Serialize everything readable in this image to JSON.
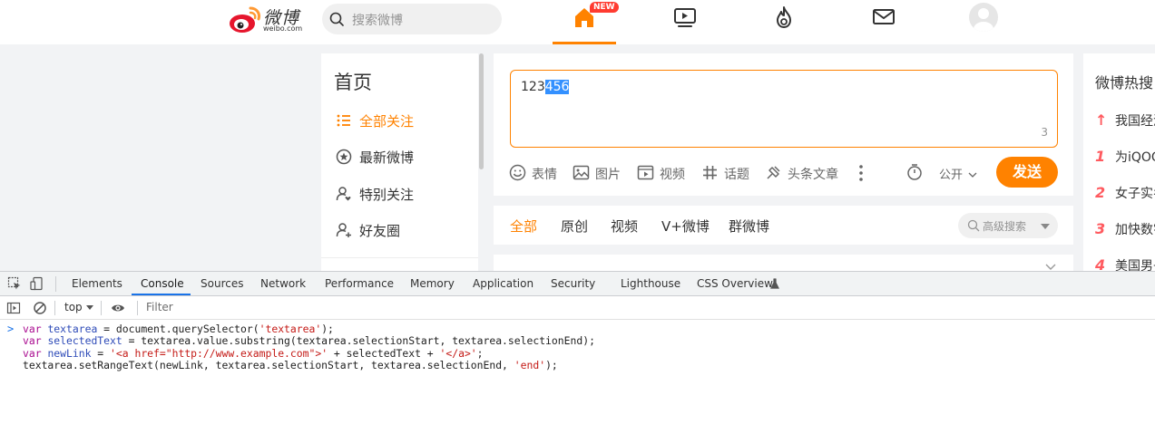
{
  "colors": {
    "brand_orange": "#ff8200",
    "hot_red": "#ff5a5f",
    "selection_blue": "#3390ff",
    "devtools_accent": "#1a73e8"
  },
  "header": {
    "logo_text": "微博",
    "logo_sub": "weibo.com",
    "search_placeholder": "搜索微博",
    "new_badge": "NEW",
    "nav_icons": [
      "home-icon",
      "video-icon",
      "hot-flame-icon",
      "mail-icon",
      "avatar"
    ]
  },
  "leftnav": {
    "title": "首页",
    "items": [
      {
        "label": "全部关注",
        "icon": "list-icon",
        "active": true
      },
      {
        "label": "最新微博",
        "icon": "star-circle-icon",
        "active": false
      },
      {
        "label": "特别关注",
        "icon": "user-heart-icon",
        "active": false
      },
      {
        "label": "好友圈",
        "icon": "user-group-icon",
        "active": false
      }
    ]
  },
  "composer": {
    "text_before": "123",
    "text_selected": "456",
    "char_count": "3",
    "tools": [
      {
        "label": "表情",
        "icon": "emoji-icon"
      },
      {
        "label": "图片",
        "icon": "image-icon"
      },
      {
        "label": "视频",
        "icon": "video-icon"
      },
      {
        "label": "话题",
        "icon": "hashtag-icon"
      },
      {
        "label": "头条文章",
        "icon": "article-icon"
      }
    ],
    "visibility": "公开",
    "send_label": "发送"
  },
  "feed_tabs": {
    "items": [
      "全部",
      "原创",
      "视频",
      "V+微博",
      "群微博"
    ],
    "active_index": 0,
    "advanced_search": "高级搜索"
  },
  "hot": {
    "title": "微博热搜",
    "items": [
      {
        "rank": "↑",
        "text": "我国经济"
      },
      {
        "rank": "1",
        "text": "为iQOO"
      },
      {
        "rank": "2",
        "text": "女子实名"
      },
      {
        "rank": "3",
        "text": "加快数字"
      },
      {
        "rank": "4",
        "text": "美国男子"
      }
    ]
  },
  "devtools": {
    "tabs": [
      "Elements",
      "Console",
      "Sources",
      "Network",
      "Performance",
      "Memory",
      "Application",
      "Security",
      "Lighthouse",
      "CSS Overview"
    ],
    "active_tab": "Console",
    "context": "top",
    "filter_placeholder": "Filter",
    "console_lines": [
      "var textarea = document.querySelector('textarea');",
      "var selectedText = textarea.value.substring(textarea.selectionStart, textarea.selectionEnd);",
      "var newLink = '<a href=\"http://www.example.com\">' + selectedText + '</a>';",
      "textarea.setRangeText(newLink, textarea.selectionStart, textarea.selectionEnd, 'end');"
    ]
  }
}
